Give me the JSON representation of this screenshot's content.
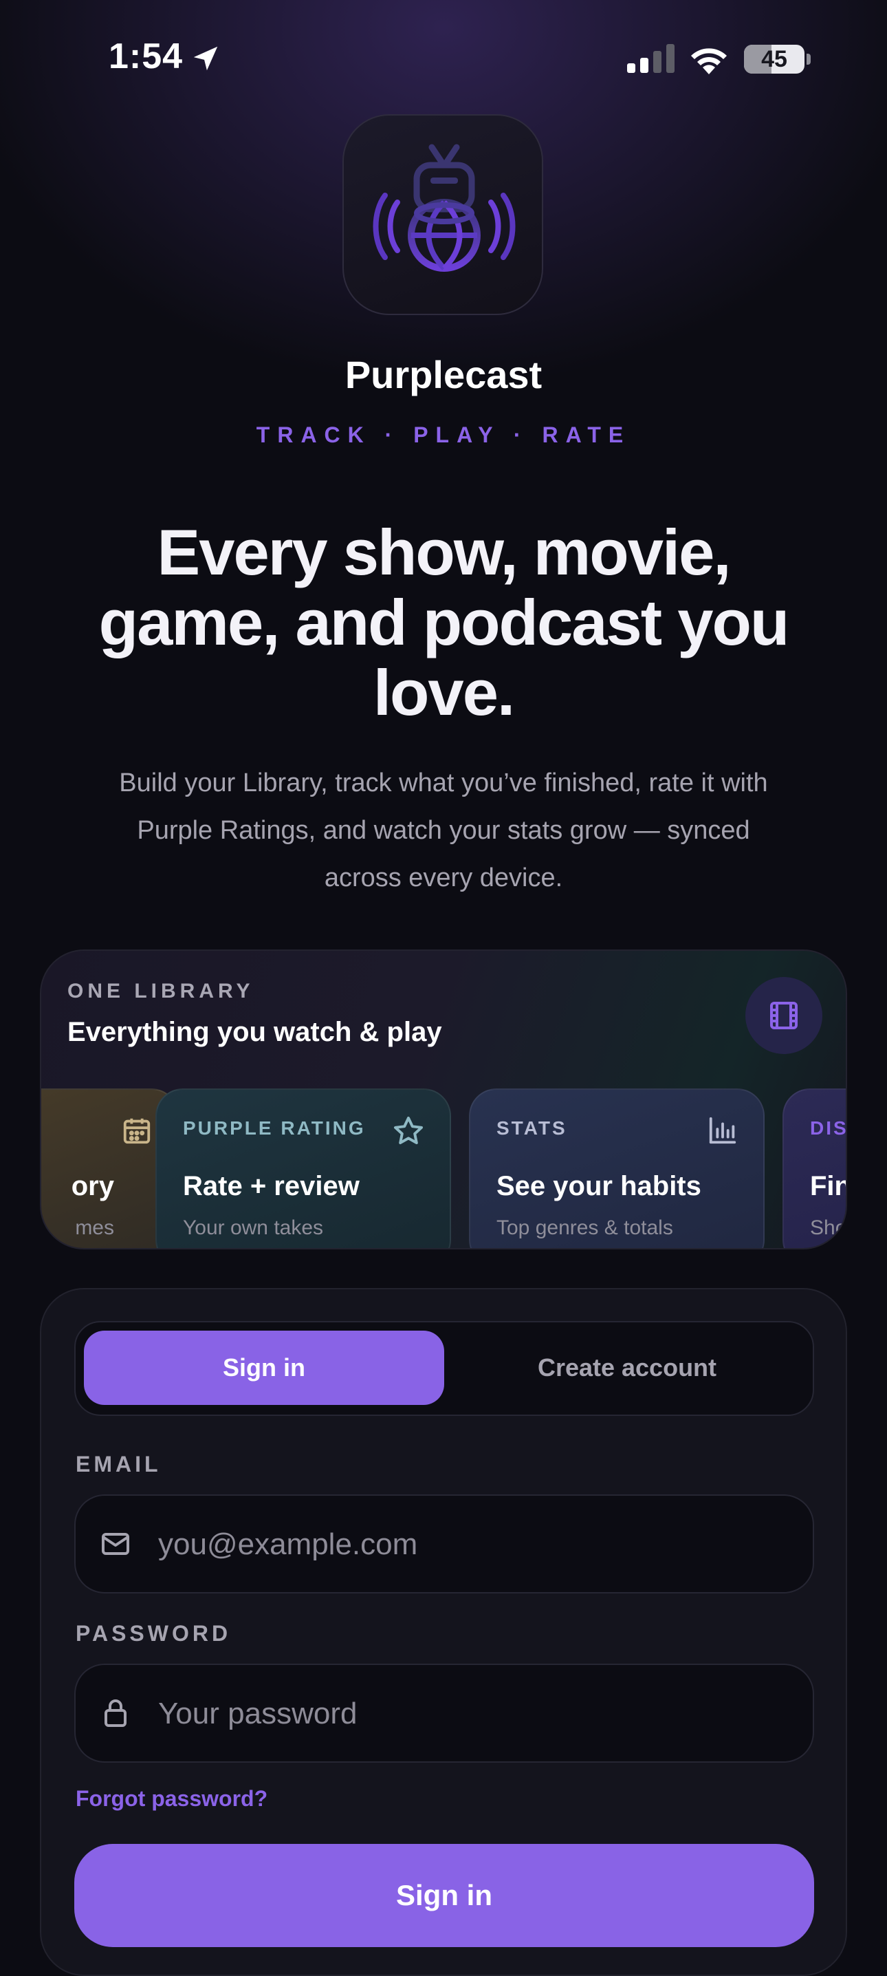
{
  "status_bar": {
    "time": "1:54",
    "battery_level": "45",
    "battery_fraction": 0.45
  },
  "app": {
    "name": "Purplecast",
    "tagline": "TRACK · PLAY · RATE",
    "icon": "purplecast-logo-icon"
  },
  "hero": {
    "title": "Every show, movie, game, and podcast you love.",
    "subtitle": "Build your Library, track what you’ve finished, rate it with Purple Ratings, and watch your stats grow — synced across every device."
  },
  "library": {
    "eyebrow": "ONE LIBRARY",
    "title": "Everything you watch & play",
    "action_icon": "film-icon",
    "cards": [
      {
        "label": "",
        "title": "ory",
        "sub": "mes",
        "icon": "calendar-icon"
      },
      {
        "label": "PURPLE RATING",
        "title": "Rate + review",
        "sub": "Your own takes",
        "icon": "star-icon"
      },
      {
        "label": "STATS",
        "title": "See your habits",
        "sub": "Top genres & totals",
        "icon": "bar-chart-icon"
      },
      {
        "label": "DISC",
        "title": "Fin",
        "sub": "Sho",
        "icon": ""
      }
    ]
  },
  "auth": {
    "tabs": {
      "sign_in": "Sign in",
      "create_account": "Create account"
    },
    "email": {
      "label": "EMAIL",
      "placeholder": "you@example.com",
      "value": ""
    },
    "password": {
      "label": "PASSWORD",
      "placeholder": "Your password",
      "value": ""
    },
    "forgot": "Forgot password?",
    "submit": "Sign in"
  },
  "colors": {
    "accent": "#8963e6",
    "accent_text": "#8b63e8",
    "background": "#0c0c13",
    "card": "#14141d"
  }
}
